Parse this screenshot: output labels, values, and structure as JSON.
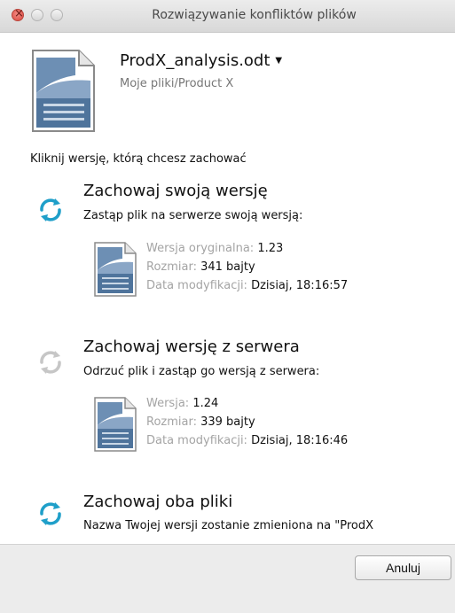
{
  "window": {
    "title": "Rozwiązywanie konfliktów plików"
  },
  "file": {
    "name": "ProdX_analysis.odt",
    "path": "Moje pliki/Product X"
  },
  "instruction": "Kliknij wersję, którą chcesz zachować",
  "options": [
    {
      "title": "Zachowaj swoją wersję",
      "subtitle": "Zastąp plik na serwerze swoją wersją:",
      "details": [
        {
          "label": "Wersja oryginalna:",
          "value": "1.23"
        },
        {
          "label": "Rozmiar:",
          "value": "341 bajty"
        },
        {
          "label": "Data modyfikacji:",
          "value": "Dzisiaj, 18:16:57"
        }
      ]
    },
    {
      "title": "Zachowaj wersję z serwera",
      "subtitle": "Odrzuć plik i zastąp go wersją z serwera:",
      "details": [
        {
          "label": "Wersja:",
          "value": "1.24"
        },
        {
          "label": "Rozmiar:",
          "value": "339 bajty"
        },
        {
          "label": "Data modyfikacji:",
          "value": "Dzisiaj, 18:16:46"
        }
      ]
    },
    {
      "title": "Zachowaj oba pliki",
      "subtitle": "Nazwa Twojej wersji zostanie zmieniona na \"ProdX"
    }
  ],
  "buttons": {
    "cancel": "Anuluj"
  },
  "colors": {
    "sync_active": "#1f9fc9",
    "sync_inactive": "#c6c6c6",
    "doc_blue": "#5b7fa6"
  }
}
